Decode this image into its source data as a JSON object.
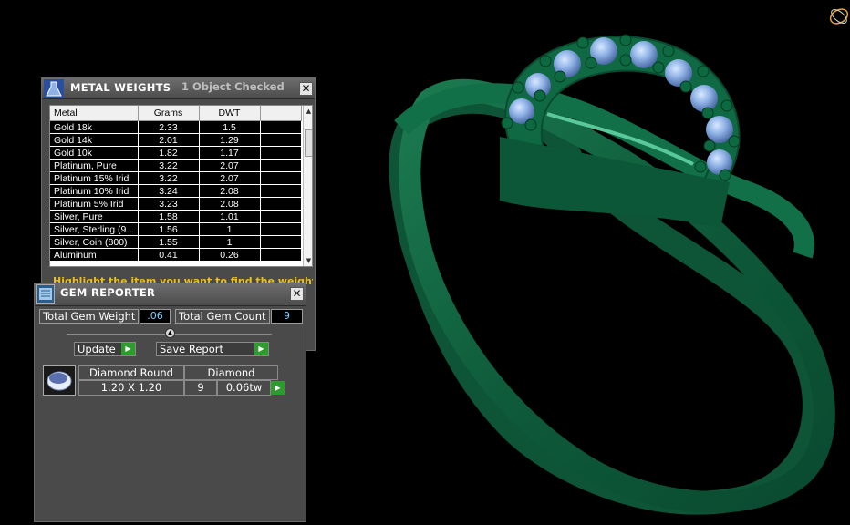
{
  "metal_weights": {
    "title": "METAL WEIGHTS",
    "status": "1 Object Checked",
    "columns": [
      "Metal",
      "Grams",
      "DWT"
    ],
    "rows": [
      [
        "Gold 18k",
        "2.33",
        "1.5"
      ],
      [
        "Gold 14k",
        "2.01",
        "1.29"
      ],
      [
        "Gold 10k",
        "1.82",
        "1.17"
      ],
      [
        "Platinum, Pure",
        "3.22",
        "2.07"
      ],
      [
        "Platinum 15% Irid",
        "3.22",
        "2.07"
      ],
      [
        "Platinum 10% Irid",
        "3.24",
        "2.08"
      ],
      [
        "Platinum 5% Irid",
        "3.23",
        "2.08"
      ],
      [
        "Silver, Pure",
        "1.58",
        "1.01"
      ],
      [
        "Silver, Sterling (9...",
        "1.56",
        "1"
      ],
      [
        "Silver, Coin (800)",
        "1.55",
        "1"
      ],
      [
        "Aluminum",
        "0.41",
        "0.26"
      ]
    ],
    "hint": "Highlight the item you want to find the weight for"
  },
  "gem_reporter": {
    "title": "GEM REPORTER",
    "total_weight_label": "Total Gem Weight",
    "total_weight_value": ".06",
    "total_count_label": "Total Gem Count",
    "total_count_value": "9",
    "update_label": "Update",
    "save_report_label": "Save Report",
    "gem": {
      "shape": "Diamond Round",
      "material": "Diamond",
      "size": "1.20 X 1.20",
      "count": "9",
      "weight": "0.06tw"
    }
  },
  "colors": {
    "ring_metal": "#0e5a3a",
    "gem_stone": "#8fb2e6",
    "panel_bg": "#4a4a4a",
    "hint_text": "#e8c020",
    "value_text": "#7fd0ff",
    "go_button": "#2e9b2e"
  },
  "icons": {
    "metal_panel": "flask-icon",
    "gem_panel": "gem-report-icon",
    "close": "close-icon",
    "go": "play-arrow-icon",
    "view_gizmo": "orbit-gizmo-icon"
  }
}
